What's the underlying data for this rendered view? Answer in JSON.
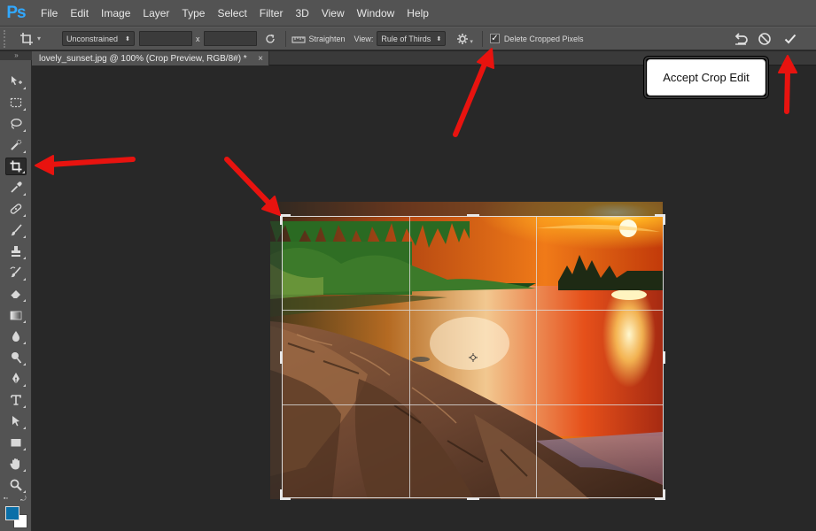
{
  "app": {
    "logo_text": "Ps",
    "menu": [
      "File",
      "Edit",
      "Image",
      "Layer",
      "Type",
      "Select",
      "Filter",
      "3D",
      "View",
      "Window",
      "Help"
    ]
  },
  "options_bar": {
    "crop_tool_icon": "crop-icon",
    "ratio_dropdown": "Unconstrained",
    "width_value": "",
    "times_symbol": "x",
    "height_value": "",
    "rotate_icon": "rotate-icon",
    "straighten_label": "Straighten",
    "view_label": "View:",
    "view_dropdown": "Rule of Thirds",
    "gear_icon": "gear-icon",
    "delete_cropped_checked": true,
    "delete_cropped_label": "Delete Cropped Pixels",
    "reset_icon": "reset-icon",
    "cancel_icon": "cancel-icon",
    "commit_icon": "checkmark-icon"
  },
  "document": {
    "tab_title": "lovely_sunset.jpg @ 100% (Crop Preview, RGB/8#) *",
    "close_glyph": "×"
  },
  "toolbar": {
    "collapse_glyph": "»",
    "tools": [
      "move-tool",
      "marquee-tool",
      "lasso-tool",
      "quick-selection-tool",
      "crop-tool",
      "eyedropper-tool",
      "healing-brush-tool",
      "brush-tool",
      "clone-stamp-tool",
      "history-brush-tool",
      "eraser-tool",
      "gradient-tool",
      "blur-tool",
      "dodge-tool",
      "pen-tool",
      "type-tool",
      "path-selection-tool",
      "rectangle-tool",
      "hand-tool",
      "zoom-tool"
    ],
    "active_tool": "crop-tool",
    "foreground_color": "#0a6fa8",
    "background_color": "#ffffff"
  },
  "annotation": {
    "callout_text": "Accept Crop Edit",
    "arrow_color": "#e8130f"
  }
}
